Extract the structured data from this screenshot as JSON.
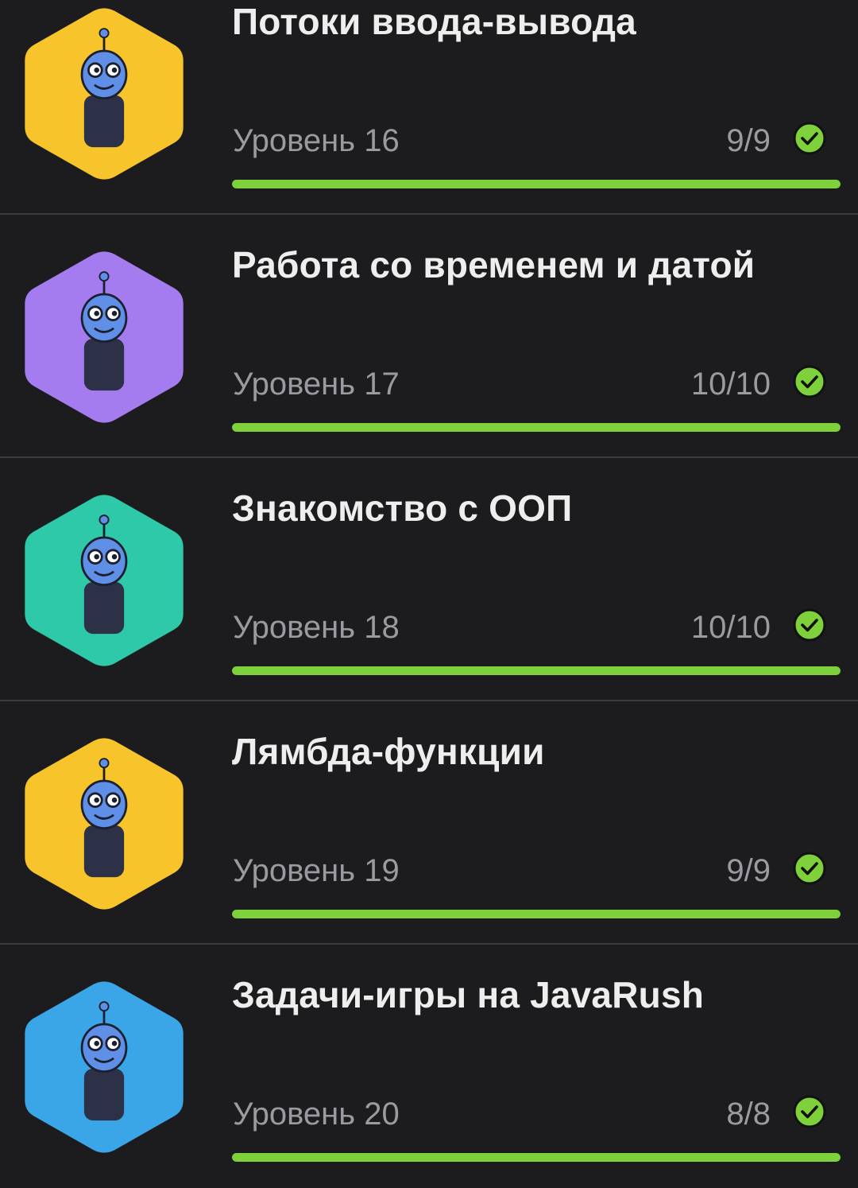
{
  "accent_color": "#7ed13b",
  "levels": [
    {
      "title": "Потоки ввода-вывода",
      "level_label": "Уровень 16",
      "progress_text": "9/9",
      "progress_fraction": 1.0,
      "thumb_color": "#f7c52b",
      "thumb_icon": "robot-in-bathtub-illustration",
      "status_icon": "check-circle-icon"
    },
    {
      "title": "Работа со временем и датой",
      "level_label": "Уровень 17",
      "progress_text": "10/10",
      "progress_fraction": 1.0,
      "thumb_color": "#a57cf0",
      "thumb_icon": "robot-with-time-wand-illustration",
      "status_icon": "check-circle-icon"
    },
    {
      "title": "Знакомство с ООП",
      "level_label": "Уровень 18",
      "progress_text": "10/10",
      "progress_fraction": 1.0,
      "thumb_color": "#2ec9a8",
      "thumb_icon": "robot-periodic-table-illustration",
      "status_icon": "check-circle-icon"
    },
    {
      "title": "Лямбда-функции",
      "level_label": "Уровень 19",
      "progress_text": "9/9",
      "progress_fraction": 1.0,
      "thumb_color": "#f7c52b",
      "thumb_icon": "robot-professor-with-pipe-illustration",
      "status_icon": "check-circle-icon"
    },
    {
      "title": "Задачи-игры на JavaRush",
      "level_label": "Уровень 20",
      "progress_text": "8/8",
      "progress_fraction": 1.0,
      "thumb_color": "#3aa6e8",
      "thumb_icon": "robot-scientist-emc2-illustration",
      "status_icon": "check-circle-icon"
    }
  ]
}
